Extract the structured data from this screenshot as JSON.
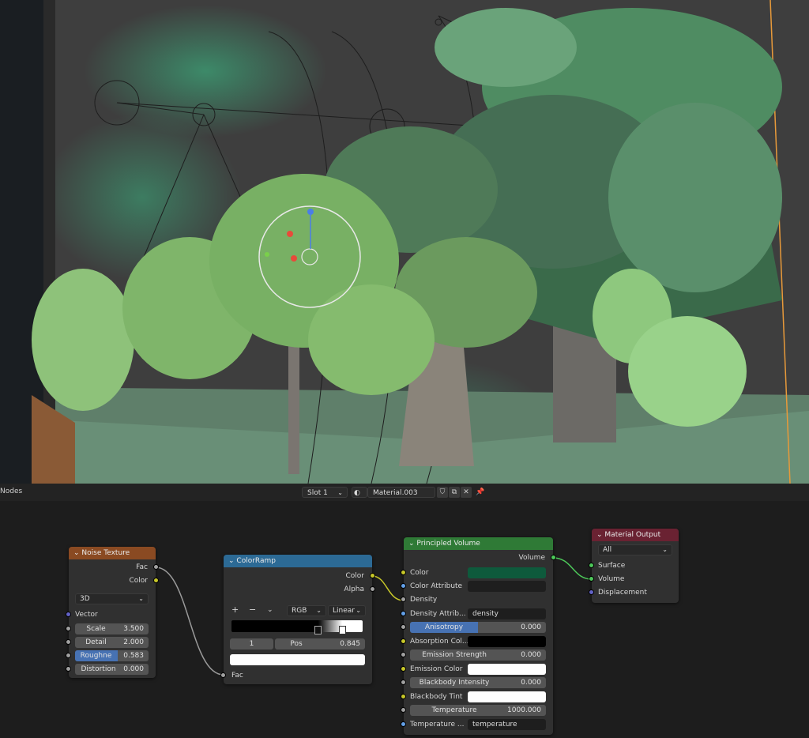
{
  "header": {
    "editor_label": "Nodes",
    "slot": "Slot 1",
    "material": "Material.003"
  },
  "noise": {
    "title": "Noise Texture",
    "out_fac": "Fac",
    "out_color": "Color",
    "dimension": "3D",
    "in_vector": "Vector",
    "scale_label": "Scale",
    "scale_value": "3.500",
    "detail_label": "Detail",
    "detail_value": "2.000",
    "rough_label": "Roughne",
    "rough_value": "0.583",
    "distortion_label": "Distortion",
    "distortion_value": "0.000"
  },
  "ramp": {
    "title": "ColorRamp",
    "out_color": "Color",
    "out_alpha": "Alpha",
    "plus": "+",
    "minus": "−",
    "mode": "RGB",
    "interp": "Linear",
    "index": "1",
    "pos_label": "Pos",
    "pos_value": "0.845",
    "in_fac": "Fac"
  },
  "volume": {
    "title": "Principled Volume",
    "out_volume": "Volume",
    "color": "Color",
    "color_attr": "Color Attribute",
    "density": "Density",
    "density_attr": "Density Attrib...",
    "density_attr_value": "density",
    "anisotropy_label": "Anisotropy",
    "anisotropy_value": "0.000",
    "absorption": "Absorption Col...",
    "emission_strength_label": "Emission Strength",
    "emission_strength_value": "0.000",
    "emission_color": "Emission Color",
    "blackbody_label": "Blackbody Intensity",
    "blackbody_value": "0.000",
    "blackbody_tint": "Blackbody Tint",
    "temperature_label": "Temperature",
    "temperature_value": "1000.000",
    "temp_attr": "Temperature ...",
    "temp_attr_value": "temperature"
  },
  "output": {
    "title": "Material Output",
    "target": "All",
    "surface": "Surface",
    "volume": "Volume",
    "displacement": "Displacement"
  },
  "colors": {
    "volume_color": "#0e5a3c",
    "noise_header": "#8a4a22",
    "ramp_header": "#2c6a95",
    "volume_header": "#2f7a36",
    "output_header": "#6a2232"
  },
  "icons": [
    "chevron-down-icon",
    "sphere-material-icon",
    "shield-icon",
    "duplicate-icon",
    "close-icon",
    "pin-icon"
  ]
}
